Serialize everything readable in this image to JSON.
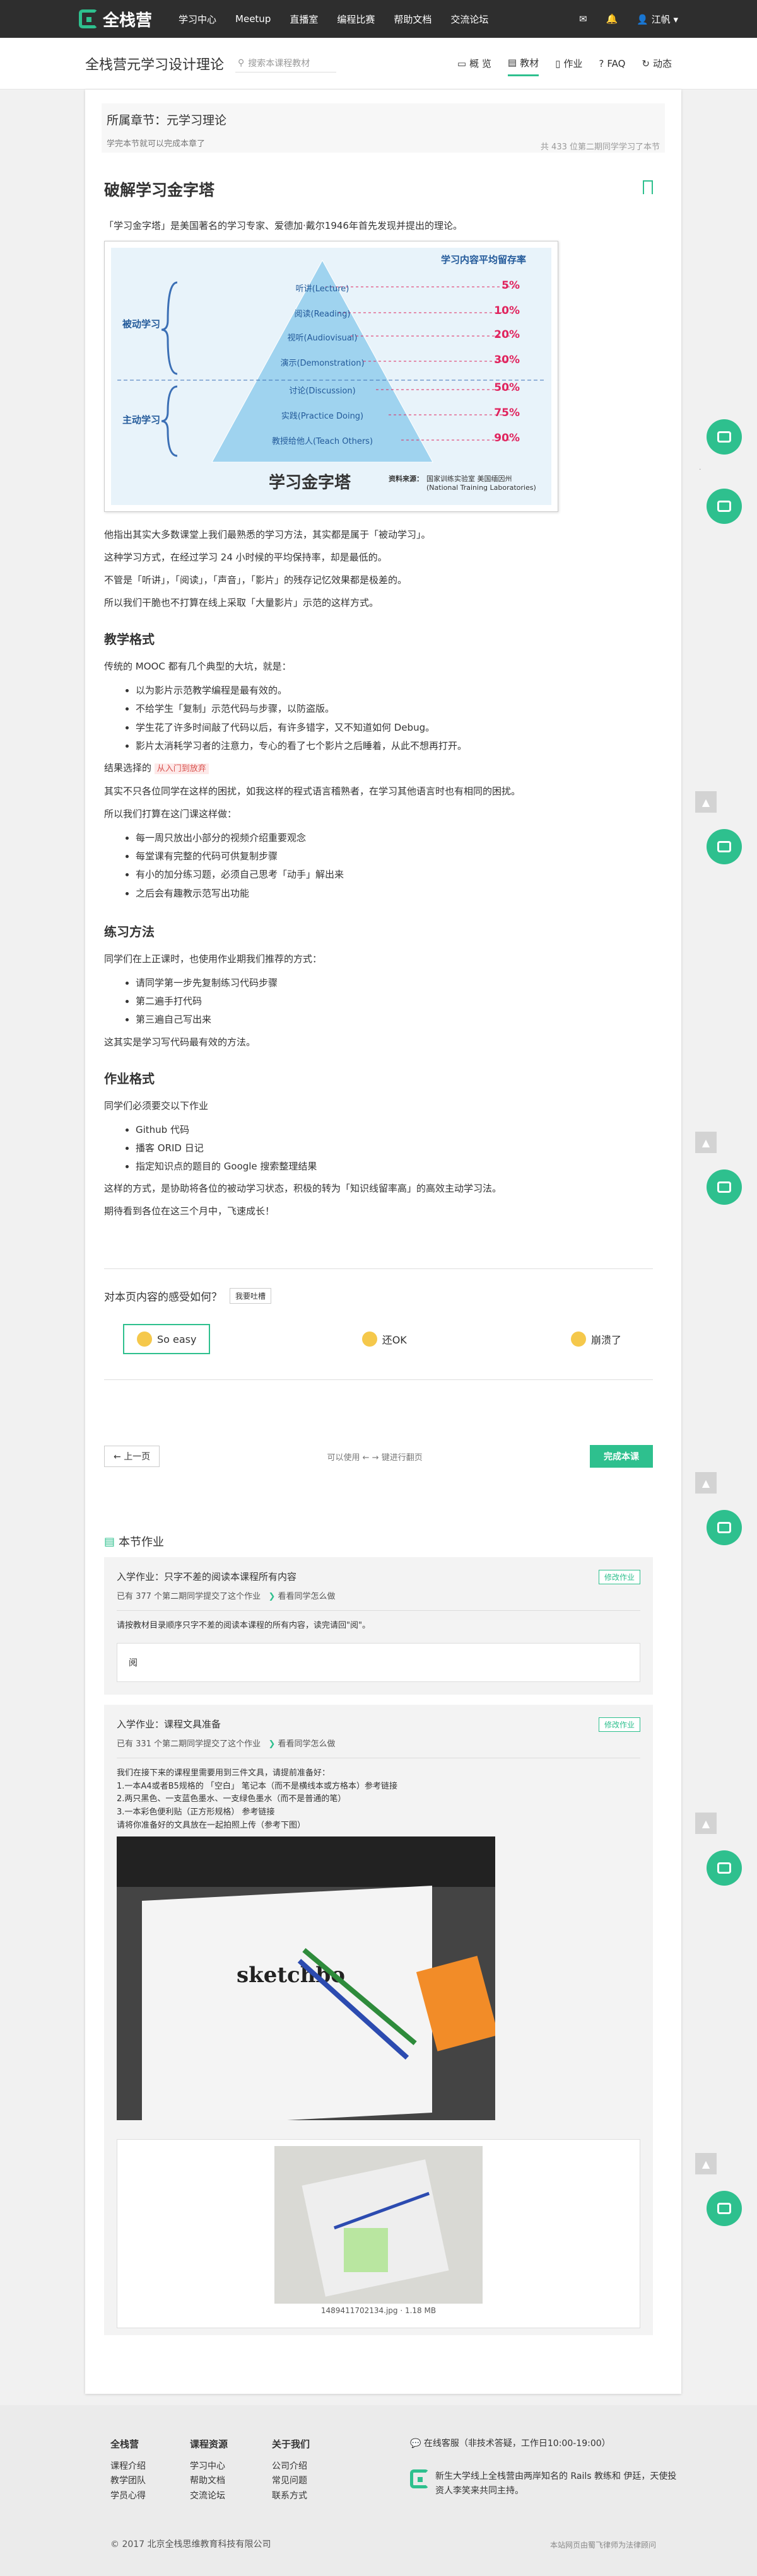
{
  "nav": {
    "logo": "全栈营",
    "links": [
      "学习中心",
      "Meetup",
      "直播室",
      "编程比赛",
      "帮助文档",
      "交流论坛"
    ],
    "user": "江帆"
  },
  "course": {
    "title": "全栈营元学习设计理论",
    "search_placeholder": "搜索本课程教材",
    "tabs": [
      "概 览",
      "教材",
      "作业",
      "FAQ",
      "动态"
    ]
  },
  "chapter": {
    "title": "所属章节：元学习理论",
    "sub": "学完本节就可以完成本章了",
    "count": "共 433 位第二期同学学习了本节"
  },
  "article": {
    "title": "破解学习金字塔",
    "intro": "「学习金字塔」是美国著名的学习专家、爱德加·戴尔1946年首先发现并提出的理论。",
    "pyramid": {
      "header": "学习内容平均留存率",
      "passive": "被动学习",
      "active": "主动学习",
      "footer": "学习金字塔",
      "source": "资料来源：",
      "source_detail": "国家训练实验室 美国缅因州 (National Training Laboratories)",
      "levels": [
        {
          "label": "听讲(Lecture)",
          "pct": "5%"
        },
        {
          "label": "阅读(Reading)",
          "pct": "10%"
        },
        {
          "label": "视听(Audiovisual)",
          "pct": "20%"
        },
        {
          "label": "演示(Demonstration)",
          "pct": "30%"
        },
        {
          "label": "讨论(Discussion)",
          "pct": "50%"
        },
        {
          "label": "实践(Practice Doing)",
          "pct": "75%"
        },
        {
          "label": "教授给他人(Teach Others)",
          "pct": "90%"
        }
      ]
    },
    "p1": "他指出其实大多数课堂上我们最熟悉的学习方法，其实都是属于「被动学习」。",
    "p2": "这种学习方式，在经过学习 24 小时候的平均保持率，却是最低的。",
    "p3": "不管是「听讲」，「阅读」，「声音」，「影片」的残存记忆效果都是极差的。",
    "p4": "所以我们干脆也不打算在线上采取「大量影片」示范的这样方式。",
    "h_teach": "教学格式",
    "p5": "传统的 MOOC 都有几个典型的大坑，就是：",
    "list1": [
      "以为影片示范教学编程是最有效的。",
      "不给学生「复制」示范代码与步骤，以防盗版。",
      "学生花了许多时间敲了代码以后，有许多错字，又不知道如何 Debug。",
      "影片太消耗学习者的注意力，专心的看了七个影片之后睡着，从此不想再打开。"
    ],
    "result_prefix": "结果选择的",
    "result_tag": "从入门到放弃",
    "p6": "其实不只各位同学在这样的困扰，如我这样的程式语言稽熟者，在学习其他语言时也有相同的困扰。",
    "p7": "所以我们打算在这门课这样做：",
    "list2": [
      "每一周只放出小部分的视频介绍重要观念",
      "每堂课有完整的代码可供复制步骤",
      "有小的加分练习题，必须自己思考「动手」解出来",
      "之后会有趣教示范写出功能"
    ],
    "h_practice": "练习方法",
    "p8": "同学们在上正课时，也使用作业期我们推荐的方式：",
    "list3": [
      "请同学第一步先复制练习代码步骤",
      "第二遍手打代码",
      "第三遍自己写出来"
    ],
    "p9": "这其实是学习写代码最有效的方法。",
    "h_hw": "作业格式",
    "p10": "同学们必须要交以下作业",
    "list4": [
      "Github 代码",
      "播客 ORID 日记",
      "指定知识点的题目的 Google 搜索整理结果"
    ],
    "p11": "这样的方式，是协助将各位的被动学习状态，积极的转为「知识线留率高」的高效主动学习法。",
    "p12": "期待看到各位在这三个月中，飞速成长！"
  },
  "feedback": {
    "question": "对本页内容的感受如何？",
    "btn": "我要吐槽",
    "options": [
      "So easy",
      "还OK",
      "崩溃了"
    ]
  },
  "pager": {
    "prev": "上一页",
    "hint": "可以使用",
    "hint2": "键进行翻页",
    "done": "完成本课"
  },
  "homework": {
    "heading": "本节作业",
    "items": [
      {
        "title": "入学作业：只字不差的阅读本课程所有内容",
        "meta": "已有 377 个第二期同学提交了这个作业",
        "view": "看看同学怎么做",
        "btn": "修改作业",
        "desc": "请按教材目录顺序只字不差的阅读本课程的所有内容，读完请回\"阅\"。",
        "desc_link": "教材目录",
        "answer": "阅"
      },
      {
        "title": "入学作业：课程文具准备",
        "meta": "已有 331 个第二期同学提交了这个作业",
        "view": "看看同学怎么做",
        "btn": "修改作业",
        "lines": [
          "我们在接下来的课程里需要用到三件文具，请提前准备好：",
          "1.一本A4或者B5规格的 「空白」 笔记本（而不是横线本或方格本）参考链接",
          "2.两只黑色、一支蓝色墨水、一支绿色墨水（而不是普通的笔）",
          "3.一本彩色便利贴（正方形规格） 参考链接",
          "请将你准备好的文具放在一起拍照上传（参考下图）"
        ],
        "photo_text": "sketchbo",
        "file": "1489411702134.jpg · 1.18 MB"
      }
    ]
  },
  "footer": {
    "cols": [
      {
        "title": "全栈营",
        "items": [
          "课程介绍",
          "教学团队",
          "学员心得"
        ]
      },
      {
        "title": "课程资源",
        "items": [
          "学习中心",
          "帮助文档",
          "交流论坛"
        ]
      },
      {
        "title": "关于我们",
        "items": [
          "公司介绍",
          "常见问题",
          "联系方式"
        ]
      }
    ],
    "service": "在线客服（非技术答疑，工作日10:00-19:00）",
    "about": "新生大学线上全栈营由两岸知名的 Rails 教练和 伊廷，天使投资人李笑来共同主持。",
    "copyright": "© 2017 北京全栈思维教育科技有限公司",
    "icp": "本站网页由蜀飞律师为法律顾问"
  },
  "colors": {
    "accent": "#2ec08e",
    "nav_bg": "#2e2e2e",
    "pyramid_bg": "#e8f3fa",
    "pct": "#e0245e"
  }
}
